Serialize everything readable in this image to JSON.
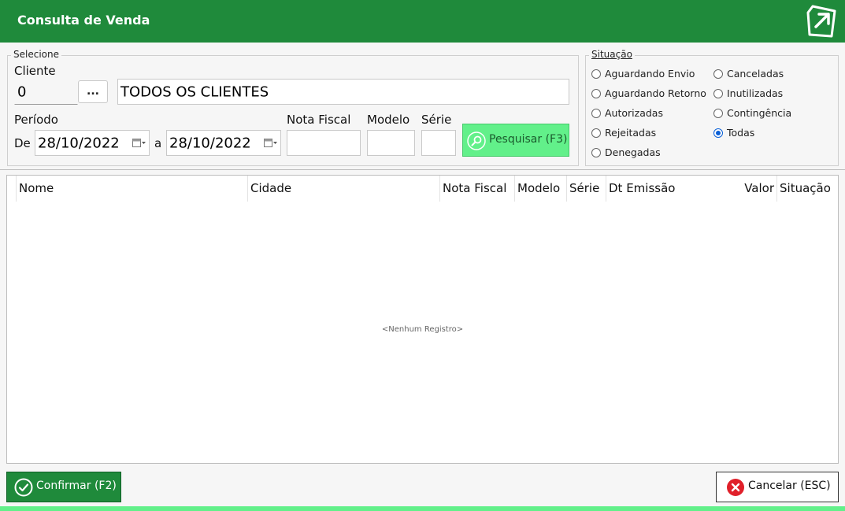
{
  "window": {
    "title": "Consulta de Venda"
  },
  "filters": {
    "legend": "Selecione",
    "cliente_label": "Cliente",
    "cliente_code": "0",
    "cliente_lookup_label": "...",
    "cliente_name": "TODOS OS CLIENTES",
    "periodo_label": "Período",
    "de_label": "De",
    "date_from": "28/10/2022",
    "a_label": "a",
    "date_to": "28/10/2022",
    "nota_fiscal_label": "Nota Fiscal",
    "nota_fiscal_value": "",
    "modelo_label": "Modelo",
    "modelo_value": "",
    "serie_label": "Série",
    "serie_value": "",
    "search_button": "Pesquisar (F3)"
  },
  "situacao": {
    "legend": "Situação",
    "options": [
      {
        "label": "Aguardando Envio",
        "selected": false
      },
      {
        "label": "Aguardando Retorno",
        "selected": false
      },
      {
        "label": "Autorizadas",
        "selected": false
      },
      {
        "label": "Rejeitadas",
        "selected": false
      },
      {
        "label": "Denegadas",
        "selected": false
      },
      {
        "label": "Canceladas",
        "selected": false
      },
      {
        "label": "Inutilizadas",
        "selected": false
      },
      {
        "label": "Contingência",
        "selected": false
      },
      {
        "label": "Todas",
        "selected": true
      }
    ]
  },
  "grid": {
    "columns": [
      "Nome",
      "Cidade",
      "Nota Fiscal",
      "Modelo",
      "Série",
      "Dt Emissão",
      "Valor",
      "Situação"
    ],
    "rows": [],
    "empty_text": "<Nenhum Registro>"
  },
  "footer": {
    "confirm_button": "Confirmar (F2)",
    "cancel_button": "Cancelar (ESC)"
  },
  "icons": {
    "exit": "exit-arrow-icon",
    "calendar": "calendar-icon",
    "search": "magnifier-icon",
    "confirm": "check-circle-icon",
    "cancel": "close-circle-icon"
  },
  "colors": {
    "titlebar": "#1f8a3b",
    "search_button": "#62f08a",
    "confirm_button": "#1f8a3b",
    "cancel_icon": "#e0202a",
    "radio_selected": "#0a5fd6"
  }
}
